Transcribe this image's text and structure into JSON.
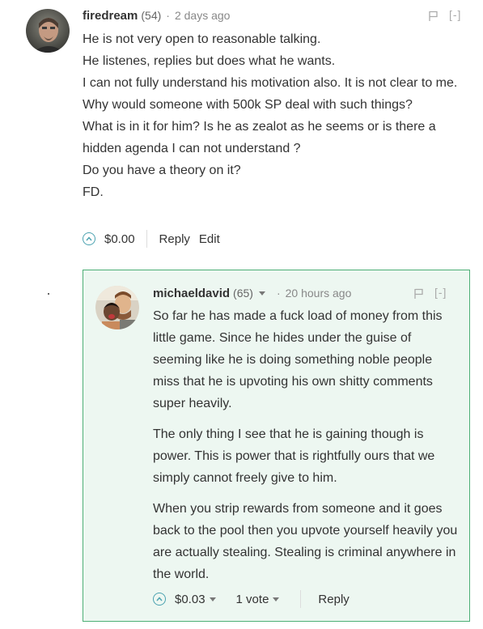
{
  "comments": [
    {
      "author": "firedream",
      "reputation": "(54)",
      "dot": "·",
      "time": "2 days ago",
      "collapse": "[-]",
      "paragraphs": [
        "He is not very open to reasonable talking.",
        "He listenes, replies but does what he wants.",
        "I can not fully understand his motivation also. It is not clear to me.",
        "Why would someone with 500k SP deal with such things?",
        "What is in it for him? Is he as zealot as he seems or is there a hidden agenda I can not understand ?",
        "Do you have a theory on it?",
        "FD."
      ],
      "payout": "$0.00",
      "reply_label": "Reply",
      "edit_label": "Edit"
    },
    {
      "author": "michaeldavid",
      "reputation": "(65)",
      "dot": "·",
      "time": "20 hours ago",
      "collapse": "[-]",
      "paragraphs": [
        "So far he has made a fuck load of money from this little game. Since he hides under the guise of seeming like he is doing something noble people miss that he is upvoting his own shitty comments super heavily.",
        "The only thing I see that he is gaining though is power. This is power that is rightfully ours that we simply cannot freely give to him.",
        "When you strip rewards from someone and it goes back to the pool then you upvote yourself heavily you are actually stealing. Stealing is criminal anywhere in the world."
      ],
      "payout": "$0.03",
      "votes": "1 vote",
      "reply_label": "Reply"
    }
  ],
  "colors": {
    "reply_bg": "#edf7f1",
    "reply_border": "#4caf75",
    "upvote": "#4ba2b0"
  },
  "icons": [
    "user-avatar",
    "flag-icon",
    "upvote-icon",
    "caret-down-icon"
  ]
}
